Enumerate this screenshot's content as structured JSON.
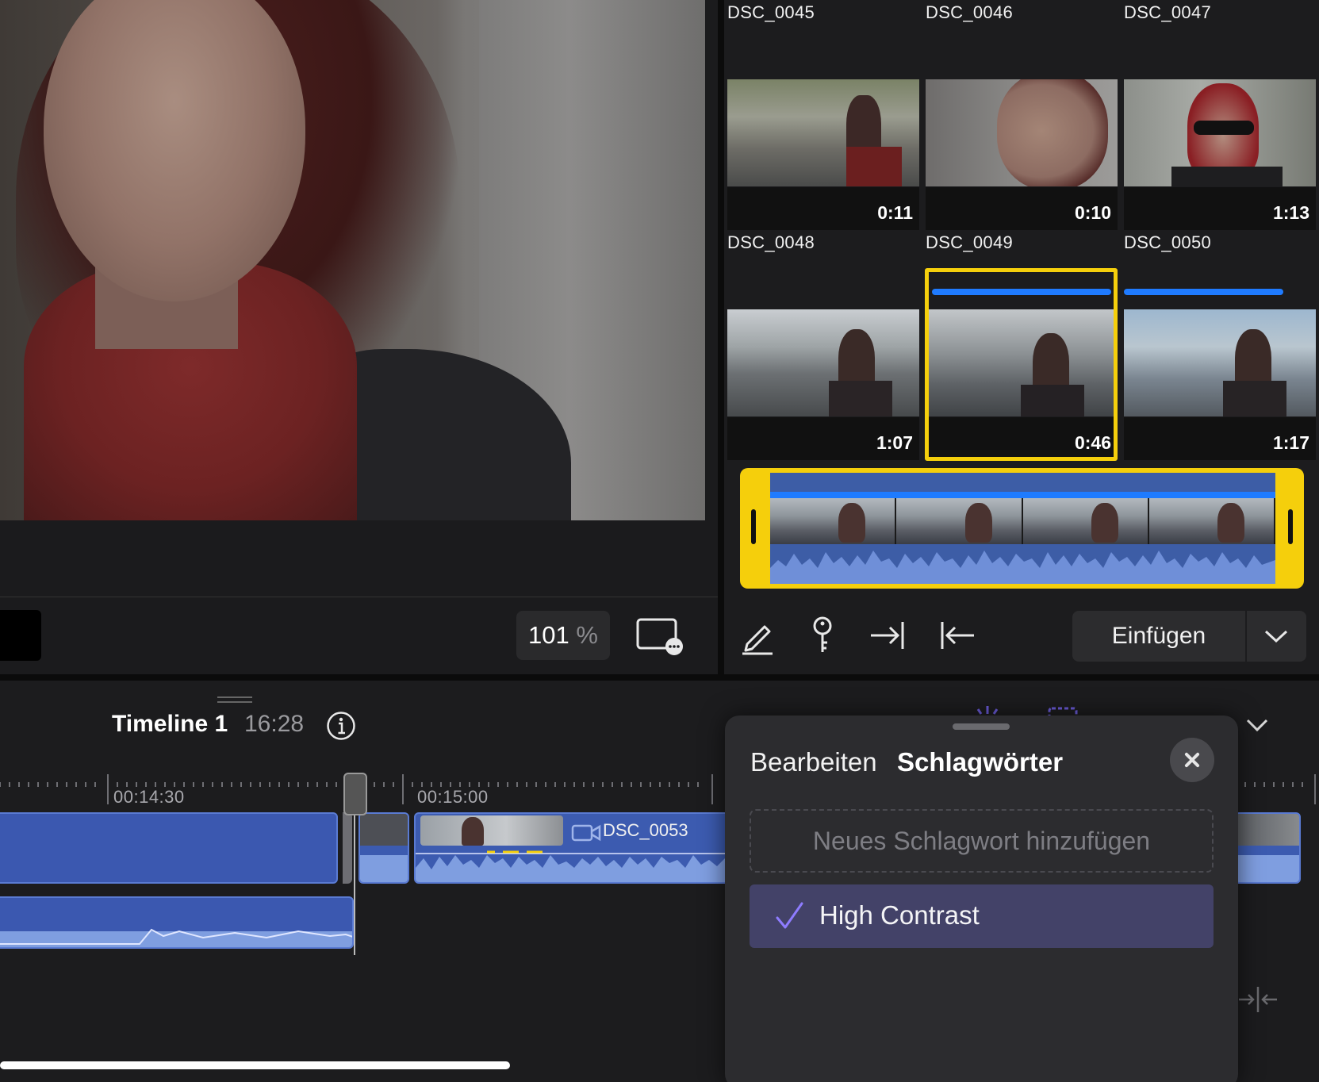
{
  "viewer": {
    "zoom_value": "101",
    "zoom_unit": "%"
  },
  "browser": {
    "clips": [
      {
        "name": "DSC_0045",
        "duration": "0:11"
      },
      {
        "name": "DSC_0046",
        "duration": "0:10"
      },
      {
        "name": "DSC_0047",
        "duration": "1:13"
      },
      {
        "name": "DSC_0048",
        "duration": "1:07"
      },
      {
        "name": "DSC_0049",
        "duration": "0:46"
      },
      {
        "name": "DSC_0050",
        "duration": "1:17"
      }
    ],
    "selected_clip": "DSC_0049",
    "insert_label": "Einfügen"
  },
  "timeline": {
    "title": "Timeline 1",
    "duration": "16:28",
    "ruler": [
      "00:14:30",
      "00:15:00"
    ],
    "clip_label": "DSC_0053"
  },
  "keywords_popover": {
    "tab_edit": "Bearbeiten",
    "tab_keywords": "Schlagwörter",
    "new_keyword_placeholder": "Neues Schlagwort hinzufügen",
    "keywords": [
      {
        "label": "High Contrast",
        "checked": true
      }
    ]
  },
  "colors": {
    "selection_yellow": "#f5cf0c",
    "range_blue": "#1f7bff",
    "clip_blue": "#3c5bb0",
    "keyword_highlight": "#434268",
    "check_purple": "#8e7cff"
  }
}
